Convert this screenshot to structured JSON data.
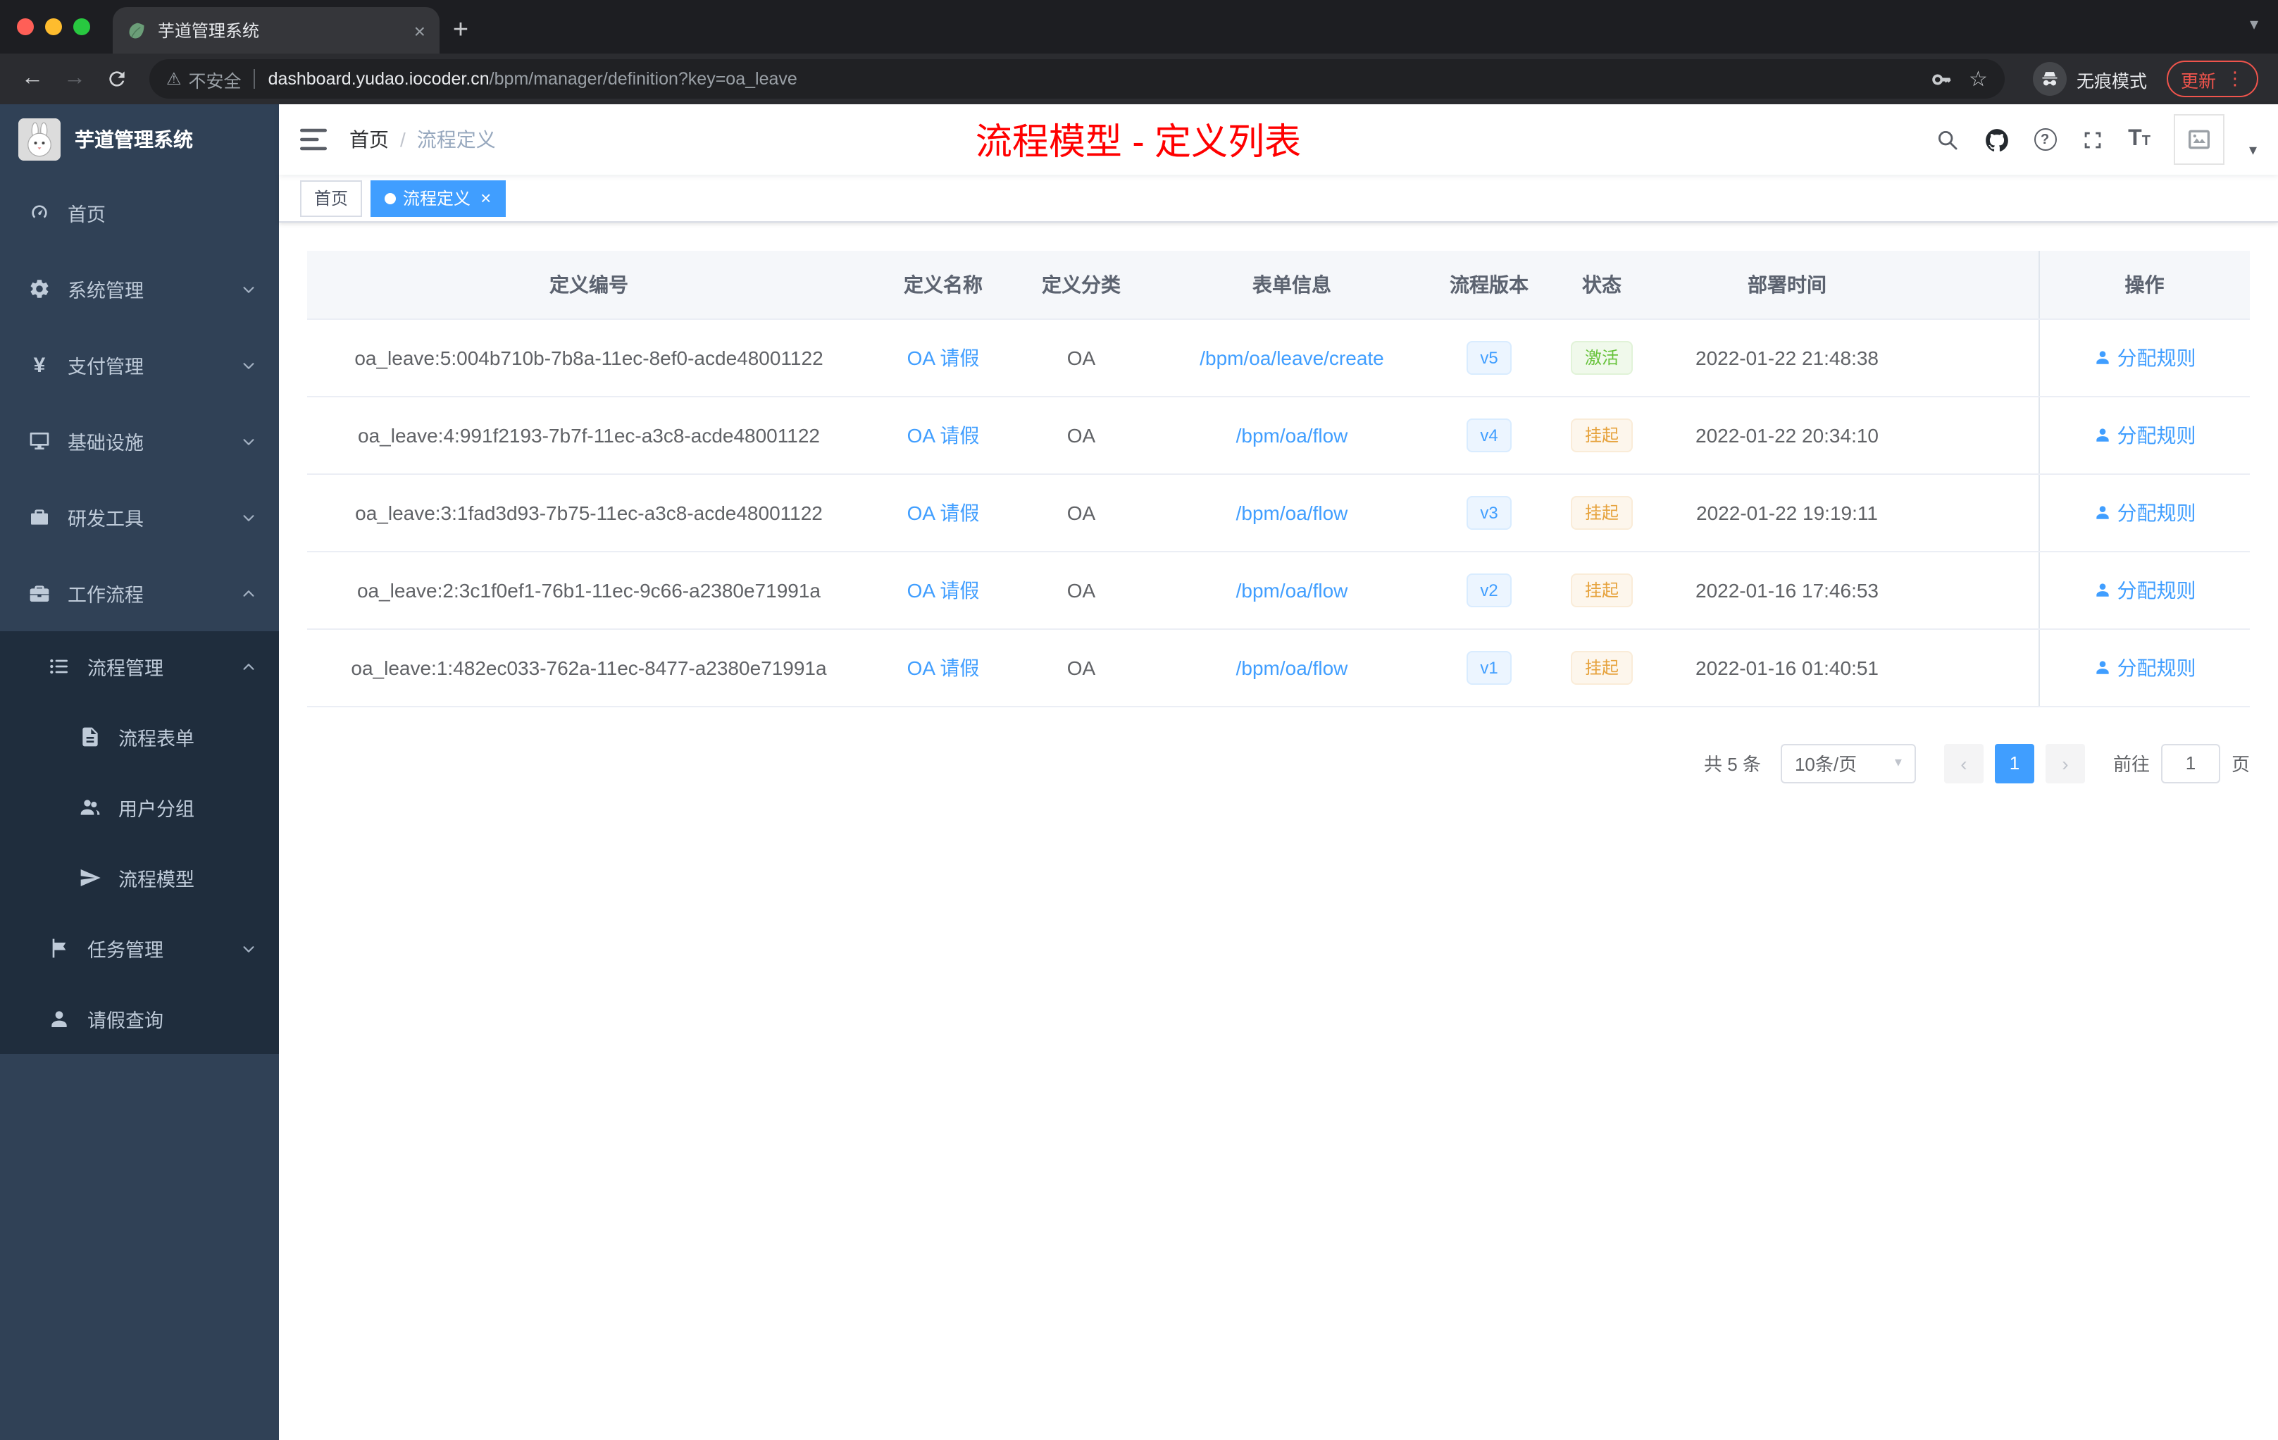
{
  "browser": {
    "tab_title": "芋道管理系统",
    "security_label": "不安全",
    "url_host": "dashboard.yudao.iocoder.cn",
    "url_path": "/bpm/manager/definition?key=oa_leave",
    "incognito_label": "无痕模式",
    "update_label": "更新"
  },
  "sidebar": {
    "logo_title": "芋道管理系统",
    "items": [
      {
        "label": "首页"
      },
      {
        "label": "系统管理"
      },
      {
        "label": "支付管理"
      },
      {
        "label": "基础设施"
      },
      {
        "label": "研发工具"
      },
      {
        "label": "工作流程"
      },
      {
        "label": "流程管理"
      },
      {
        "label": "流程表单"
      },
      {
        "label": "用户分组"
      },
      {
        "label": "流程模型"
      },
      {
        "label": "任务管理"
      },
      {
        "label": "请假查询"
      }
    ]
  },
  "header": {
    "breadcrumb_home": "首页",
    "breadcrumb_current": "流程定义",
    "overlay_title": "流程模型 - 定义列表"
  },
  "tags": {
    "home": "首页",
    "current": "流程定义"
  },
  "table": {
    "columns": [
      "定义编号",
      "定义名称",
      "定义分类",
      "表单信息",
      "流程版本",
      "状态",
      "部署时间",
      "操作"
    ],
    "rows": [
      {
        "id": "oa_leave:5:004b710b-7b8a-11ec-8ef0-acde48001122",
        "name": "OA 请假",
        "category": "OA",
        "form": "/bpm/oa/leave/create",
        "version": "v5",
        "status": "激活",
        "status_type": "success",
        "deploy_time": "2022-01-22 21:48:38",
        "action": "分配规则"
      },
      {
        "id": "oa_leave:4:991f2193-7b7f-11ec-a3c8-acde48001122",
        "name": "OA 请假",
        "category": "OA",
        "form": "/bpm/oa/flow",
        "version": "v4",
        "status": "挂起",
        "status_type": "warning",
        "deploy_time": "2022-01-22 20:34:10",
        "action": "分配规则"
      },
      {
        "id": "oa_leave:3:1fad3d93-7b75-11ec-a3c8-acde48001122",
        "name": "OA 请假",
        "category": "OA",
        "form": "/bpm/oa/flow",
        "version": "v3",
        "status": "挂起",
        "status_type": "warning",
        "deploy_time": "2022-01-22 19:19:11",
        "action": "分配规则"
      },
      {
        "id": "oa_leave:2:3c1f0ef1-76b1-11ec-9c66-a2380e71991a",
        "name": "OA 请假",
        "category": "OA",
        "form": "/bpm/oa/flow",
        "version": "v2",
        "status": "挂起",
        "status_type": "warning",
        "deploy_time": "2022-01-16 17:46:53",
        "action": "分配规则"
      },
      {
        "id": "oa_leave:1:482ec033-762a-11ec-8477-a2380e71991a",
        "name": "OA 请假",
        "category": "OA",
        "form": "/bpm/oa/flow",
        "version": "v1",
        "status": "挂起",
        "status_type": "warning",
        "deploy_time": "2022-01-16 01:40:51",
        "action": "分配规则"
      }
    ]
  },
  "pagination": {
    "total": "共 5 条",
    "page_size": "10条/页",
    "current_page": "1",
    "goto_label": "前往",
    "goto_value": "1",
    "goto_unit": "页"
  },
  "colors": {
    "primary": "#409eff",
    "success": "#67c23a",
    "warning": "#e6a23c",
    "title_red": "#ff0000",
    "sidebar_bg": "#304156",
    "submenu_bg": "#1f2d3d"
  }
}
